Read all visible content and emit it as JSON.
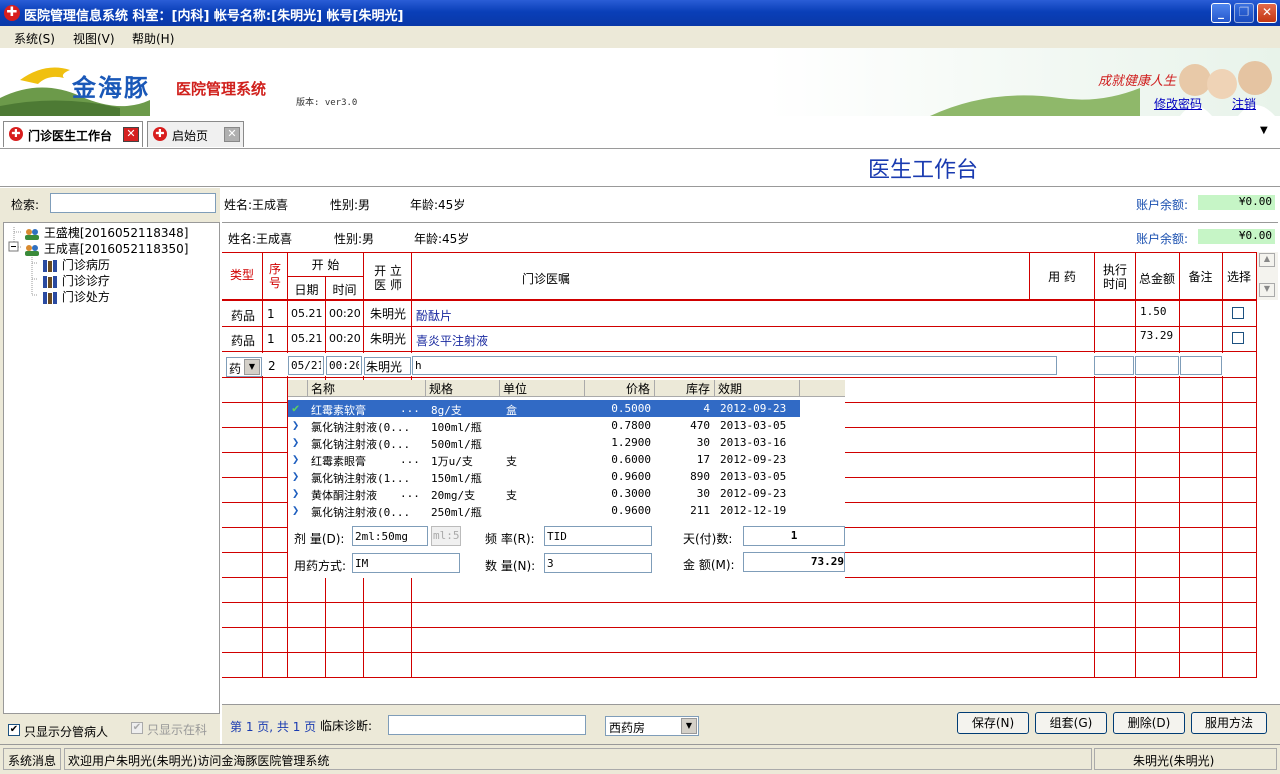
{
  "window": {
    "title": "医院管理信息系统 科室：[内科] 帐号名称:[朱明光] 帐号[朱明光]"
  },
  "menu": [
    "系统(S)",
    "视图(V)",
    "帮助(H)"
  ],
  "banner": {
    "logo_text": "金海豚",
    "logo_sub": "医院管理系统",
    "version": "版本: ver3.0",
    "slogan": "成就健康人生",
    "change_password": "修改密码",
    "logout": "注销"
  },
  "tabs": [
    {
      "label": "门诊医生工作台"
    },
    {
      "label": "启始页"
    }
  ],
  "header": {
    "title": "医生工作台"
  },
  "search": {
    "label": "检索:",
    "value": ""
  },
  "patient_bar": {
    "name": "姓名:王成喜",
    "gender": "性别:男",
    "age": "年龄:45岁",
    "balance_label": "账户余额:",
    "balance": "¥0.00"
  },
  "patient_bar2": {
    "name": "姓名:王成喜",
    "gender": "性别:男",
    "age": "年龄:45岁",
    "balance_label": "账户余额:",
    "balance": "¥0.00"
  },
  "tree": [
    {
      "label": "王盛槐[2016052118348]",
      "level": 0
    },
    {
      "label": "王成喜[2016052118350]",
      "level": 0
    },
    {
      "label": "门诊病历",
      "level": 1
    },
    {
      "label": "门诊诊疗",
      "level": 1
    },
    {
      "label": "门诊处方",
      "level": 1
    }
  ],
  "left_options": {
    "only_mine": "只显示分管病人",
    "only_dept": "只显示在科"
  },
  "grid": {
    "headers": {
      "type": "类型",
      "seq": "序号",
      "start": "开 始",
      "date": "日期",
      "time": "时间",
      "doctor": "开 立 医 师",
      "order": "门诊医嘱",
      "usage": "用 药",
      "exec_time": "执行时间",
      "total": "总金额",
      "note": "备注",
      "select": "选择"
    },
    "rows": [
      {
        "type": "药品",
        "seq": "1",
        "date": "05.21",
        "time": "00:20",
        "doctor": "朱明光",
        "order": "酚酞片",
        "total": "1.50"
      },
      {
        "type": "药品",
        "seq": "1",
        "date": "05.21",
        "time": "00:20",
        "doctor": "朱明光",
        "order": "喜炎平注射液",
        "total": "73.29"
      }
    ],
    "edit_row": {
      "type": "药",
      "seq": "2",
      "date": "05/21",
      "time": "00:20",
      "doctor": "朱明光",
      "order": "h"
    }
  },
  "popup": {
    "headers": [
      "名称",
      "规格",
      "单位",
      "价格",
      "库存",
      "效期"
    ],
    "rows": [
      {
        "name": "红霉素软膏",
        "dots": "...",
        "spec": "8g/支",
        "unit": "盒",
        "price": "0.5000",
        "stock": "4",
        "expiry": "2012-09-23",
        "selected": true
      },
      {
        "name": "氯化钠注射液(0...",
        "dots": "",
        "spec": "100ml/瓶",
        "unit": "",
        "price": "0.7800",
        "stock": "470",
        "expiry": "2013-03-05",
        "selected": false
      },
      {
        "name": "氯化钠注射液(0...",
        "dots": "",
        "spec": "500ml/瓶",
        "unit": "",
        "price": "1.2900",
        "stock": "30",
        "expiry": "2013-03-16",
        "selected": false
      },
      {
        "name": "红霉素眼膏",
        "dots": "...",
        "spec": "1万u/支",
        "unit": "支",
        "price": "0.6000",
        "stock": "17",
        "expiry": "2012-09-23",
        "selected": false
      },
      {
        "name": "氯化钠注射液(1...",
        "dots": "",
        "spec": "150ml/瓶",
        "unit": "",
        "price": "0.9600",
        "stock": "890",
        "expiry": "2013-03-05",
        "selected": false
      },
      {
        "name": "黄体酮注射液",
        "dots": "...",
        "spec": "20mg/支",
        "unit": "支",
        "price": "0.3000",
        "stock": "30",
        "expiry": "2012-09-23",
        "selected": false
      },
      {
        "name": "氯化钠注射液(0...",
        "dots": "",
        "spec": "250ml/瓶",
        "unit": "",
        "price": "0.9600",
        "stock": "211",
        "expiry": "2012-12-19",
        "selected": false
      }
    ],
    "form": {
      "dose_label": "剂 量(D):",
      "dose_value": "2ml:50mg",
      "dose_unit": "ml:5",
      "freq_label": "频 率(R):",
      "freq_value": "TID",
      "days_label": "天(付)数:",
      "days_value": "1",
      "route_label": "用药方式:",
      "route_value": "IM",
      "qty_label": "数 量(N):",
      "qty_value": "3",
      "amount_label": "金 额(M):",
      "amount_value": "73.29"
    }
  },
  "footer": {
    "page": "第 1 页, 共 1 页",
    "diagnosis_label": "临床诊断:",
    "diagnosis_value": "",
    "pharmacy": "西药房",
    "save": "保存(N)",
    "group": "组套(G)",
    "delete": "删除(D)",
    "usage": "服用方法"
  },
  "status": {
    "label": "系统消息",
    "message": "欢迎用户朱明光(朱明光)访问金海豚医院管理系统",
    "user": "朱明光(朱明光)"
  }
}
